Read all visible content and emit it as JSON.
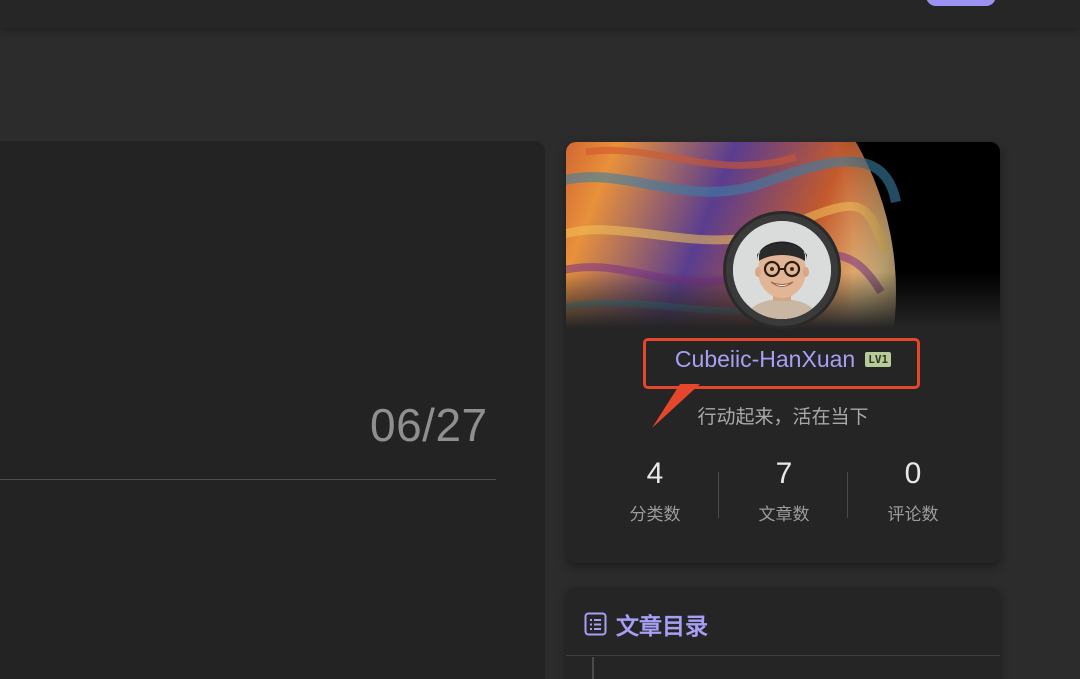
{
  "post": {
    "date": "06/27"
  },
  "author": {
    "name": "Cubeiic-HanXuan",
    "level_badge": "LV1",
    "motto": "行动起来，活在当下",
    "stats": [
      {
        "value": "4",
        "label": "分类数"
      },
      {
        "value": "7",
        "label": "文章数"
      },
      {
        "value": "0",
        "label": "评论数"
      }
    ]
  },
  "toc": {
    "title": "文章目录",
    "icon": "list-icon"
  },
  "colors": {
    "accent": "#a79ff5",
    "annotation": "#e6472c",
    "card_bg": "#252525",
    "page_bg": "#2c2c2c"
  }
}
